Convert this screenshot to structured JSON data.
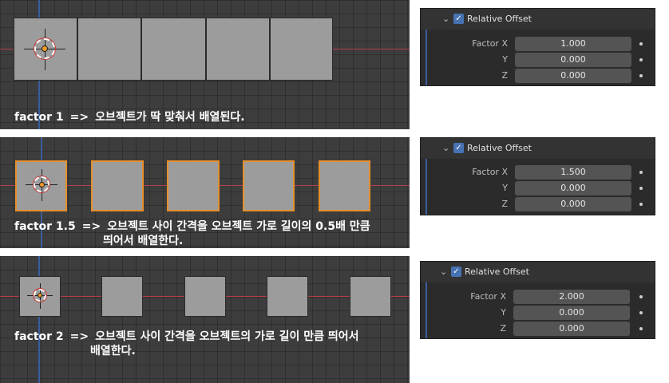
{
  "panels": [
    {
      "caption_factor": "factor 1",
      "caption_arrow": "=>",
      "caption_line1": "오브젝트가 딱 맞춰서 배열된다.",
      "caption_line2": "",
      "header_title": "Relative Offset",
      "rows": [
        {
          "label": "Factor X",
          "value": "1.000"
        },
        {
          "label": "Y",
          "value": "0.000"
        },
        {
          "label": "Z",
          "value": "0.000"
        }
      ]
    },
    {
      "caption_factor": "factor 1.5",
      "caption_arrow": "=>",
      "caption_line1": "오브젝트 사이 간격을 오브젝트 가로 길이의 0.5배 만큼",
      "caption_line2": "띄어서 배열한다.",
      "header_title": "Relative Offset",
      "rows": [
        {
          "label": "Factor X",
          "value": "1.500"
        },
        {
          "label": "Y",
          "value": "0.000"
        },
        {
          "label": "Z",
          "value": "0.000"
        }
      ]
    },
    {
      "caption_factor": "factor 2",
      "caption_arrow": "=>",
      "caption_line1": "오브젝트 사이 간격을 오브젝트의 가로 길이 만큼 띄어서",
      "caption_line2": "배열한다.",
      "header_title": "Relative Offset",
      "rows": [
        {
          "label": "Factor X",
          "value": "2.000"
        },
        {
          "label": "Y",
          "value": "0.000"
        },
        {
          "label": "Z",
          "value": "0.000"
        }
      ]
    }
  ],
  "icons": {
    "header_expand": "chevron-down-icon",
    "header_enabled": "checkbox-icon",
    "row_keyframe": "dot-icon"
  },
  "colors": {
    "viewport_bg": "#3d3d3d",
    "x_axis": "#b2404b",
    "y_axis": "#3a5e9c",
    "object_fill": "#9c9c9c",
    "selection_outline": "#e58f2e",
    "panel_bg": "#2b2b2b",
    "field_bg": "#545454",
    "checkbox": "#4772b3"
  }
}
